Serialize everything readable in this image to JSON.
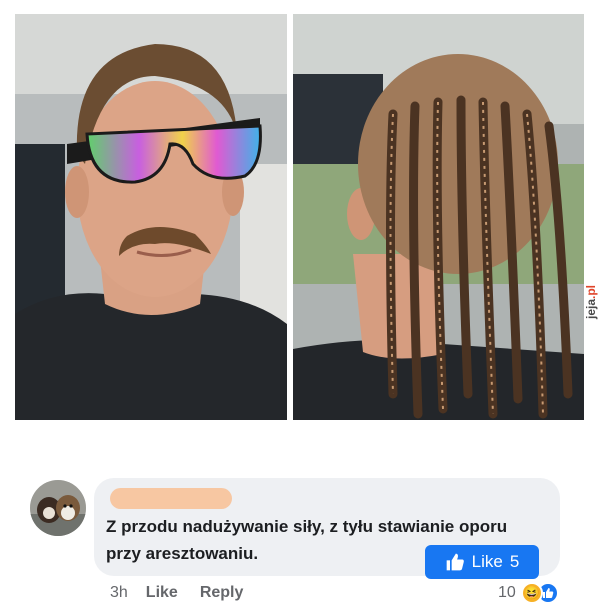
{
  "watermark": {
    "name": "jeja",
    "domain": ".pl"
  },
  "comment": {
    "text": "Z przodu nadużywanie siły, z tyłu stawianie oporu przy aresztowaniu.",
    "like_chip": {
      "label": "Like",
      "count": "5"
    },
    "timestamp": "3h",
    "actions": {
      "like": "Like",
      "reply": "Reply"
    },
    "reactions": {
      "count": "10",
      "types": [
        "haha-icon",
        "like-icon"
      ]
    }
  },
  "colors": {
    "like_blue": "#1877f2",
    "bubble_bg": "#eef0f3",
    "redaction": "#f7c7a2",
    "meta_text": "#65676b"
  }
}
